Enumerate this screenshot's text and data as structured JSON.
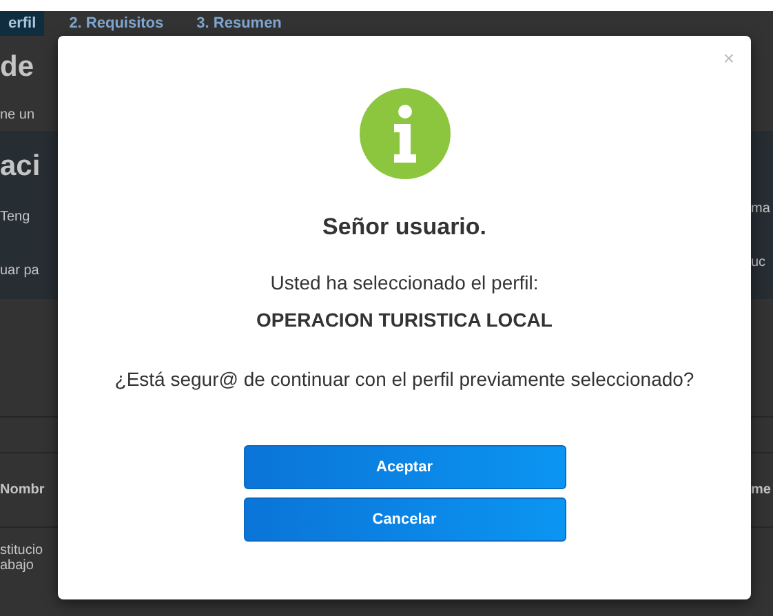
{
  "tabs": [
    {
      "label": "erfil",
      "selected": true
    },
    {
      "label": "2. Requisitos",
      "selected": false
    },
    {
      "label": "3. Resumen",
      "selected": false
    }
  ],
  "background_left": {
    "heading": "de",
    "subtitle": "ne un",
    "panel_title": "aci",
    "panel_text": "Teng",
    "panel_link": "uar pa",
    "table_header": "Nombr",
    "table_cell_lines": [
      "stitucio",
      "abajo"
    ]
  },
  "background_right": {
    "panel_text": "ma",
    "panel_link": "uc",
    "table_header": "me"
  },
  "dialog": {
    "close": "×",
    "title": "Señor usuario.",
    "message": "Usted ha seleccionado el perfil:",
    "profile": "OPERACION TURISTICA LOCAL",
    "question": "¿Está segur@ de continuar con el perfil previamente seleccionado?",
    "buttons": [
      "Aceptar",
      "Cancelar"
    ]
  }
}
